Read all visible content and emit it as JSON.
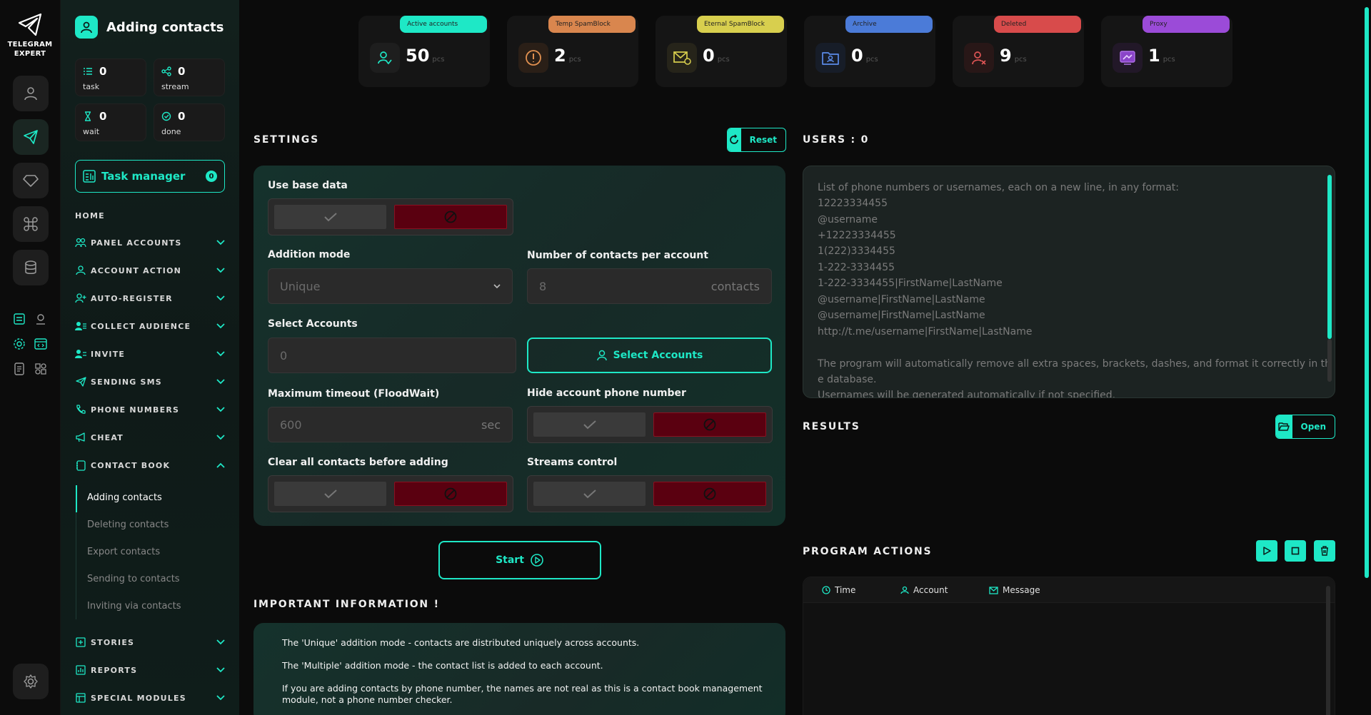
{
  "app": {
    "logo_line1": "TELEGRAM",
    "logo_line2": "EXPERT"
  },
  "sidebar": {
    "title": "Adding contacts",
    "stats": [
      {
        "value": "0",
        "label": "task"
      },
      {
        "value": "0",
        "label": "stream"
      },
      {
        "value": "0",
        "label": "wait"
      },
      {
        "value": "0",
        "label": "done"
      }
    ],
    "task_manager": {
      "label": "Task manager",
      "count": "0"
    },
    "home": "HOME",
    "nav": [
      {
        "label": "PANEL ACCOUNTS"
      },
      {
        "label": "ACCOUNT ACTION"
      },
      {
        "label": "AUTO-REGISTER"
      },
      {
        "label": "COLLECT AUDIENCE"
      },
      {
        "label": "INVITE"
      },
      {
        "label": "SENDING SMS"
      },
      {
        "label": "PHONE NUMBERS"
      },
      {
        "label": "CHEAT"
      },
      {
        "label": "CONTACT BOOK"
      },
      {
        "label": "STORIES"
      },
      {
        "label": "REPORTS"
      },
      {
        "label": "SPECIAL MODULES"
      }
    ],
    "contact_book_items": [
      "Adding contacts",
      "Deleting contacts",
      "Export contacts",
      "Sending to contacts",
      "Inviting via contacts"
    ]
  },
  "cards": [
    {
      "tag": "Active accounts",
      "value": "50",
      "unit": "pcs",
      "color": "#1ee8c6"
    },
    {
      "tag": "Temp SpamBlock",
      "value": "2",
      "unit": "pcs",
      "color": "#d9864e"
    },
    {
      "tag": "Eternal SpamBlock",
      "value": "0",
      "unit": "pcs",
      "color": "#d8cf4e"
    },
    {
      "tag": "Archive",
      "value": "0",
      "unit": "pcs",
      "color": "#4b7bd8"
    },
    {
      "tag": "Deleted",
      "value": "9",
      "unit": "pcs",
      "color": "#d84b4b"
    },
    {
      "tag": "Proxy",
      "value": "1",
      "unit": "pcs",
      "color": "#9b4bd8"
    }
  ],
  "settings": {
    "heading": "SETTINGS",
    "reset_label": "Reset",
    "use_base_data": "Use base data",
    "addition_mode": {
      "label": "Addition mode",
      "value": "Unique"
    },
    "contacts_per_account": {
      "label": "Number of contacts per account",
      "value": "8",
      "suffix": "contacts"
    },
    "select_accounts": {
      "label": "Select Accounts",
      "value": "0",
      "button": "Select Accounts"
    },
    "max_timeout": {
      "label": "Maximum timeout (FloodWait)",
      "value": "600",
      "suffix": "sec"
    },
    "hide_phone": "Hide account phone number",
    "clear_contacts": "Clear all contacts before adding",
    "streams_control": "Streams control",
    "start_label": "Start"
  },
  "important": {
    "heading": "IMPORTANT INFORMATION !",
    "lines": [
      "The 'Unique' addition mode - contacts are distributed uniquely across accounts.",
      "The 'Multiple' addition mode - the contact list is added to each account.",
      "If you are adding contacts by phone number, the names are not real as this is a contact book management module, not a phone number checker."
    ]
  },
  "users": {
    "heading": "USERS : 0",
    "placeholder_lines": [
      "List of phone numbers or usernames, each on a new line, in any format:",
      "12223334455",
      "@username",
      "+12223334455",
      "1(222)3334455",
      "1-222-3334455",
      "1-222-3334455|FirstName|LastName",
      "@username|FirstName|LastName",
      "@username|FirstName|LastName",
      "http://t.me/username|FirstName|LastName",
      "",
      "The program will automatically remove all extra spaces, brackets, dashes, and format it correctly in th",
      "e database.",
      "Usernames will be generated automatically if not specified."
    ]
  },
  "results": {
    "heading": "RESULTS",
    "open_label": "Open"
  },
  "program_actions": {
    "heading": "PROGRAM ACTIONS",
    "columns": [
      "Time",
      "Account",
      "Message"
    ]
  }
}
